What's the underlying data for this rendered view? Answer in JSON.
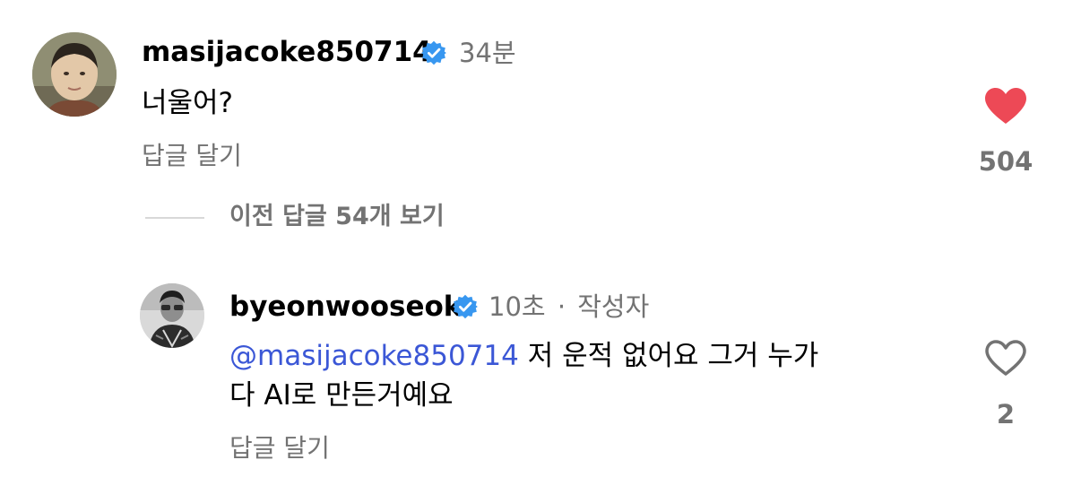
{
  "comment": {
    "username": "masijacoke850714",
    "time": "34분",
    "text": "너울어?",
    "reply_label": "답글 달기",
    "likes": "504",
    "liked": true
  },
  "view_replies_label": "이전 답글 54개 보기",
  "reply": {
    "username": "byeonwooseok",
    "time": "10초",
    "separator": "·",
    "author_badge": "작성자",
    "mention": "@masijacoke850714",
    "text_line1": " 저 운적 없어요 그거 누가",
    "text_line2": "다 AI로 만든거예요",
    "reply_label": "답글 달기",
    "likes": "2",
    "liked": false
  },
  "colors": {
    "verified": "#3897f0",
    "like_active": "#ed4956",
    "mention": "#3b57d6",
    "secondary_text": "#737373"
  },
  "icons": {
    "verified": "verified-badge-icon",
    "like": "heart-icon"
  }
}
